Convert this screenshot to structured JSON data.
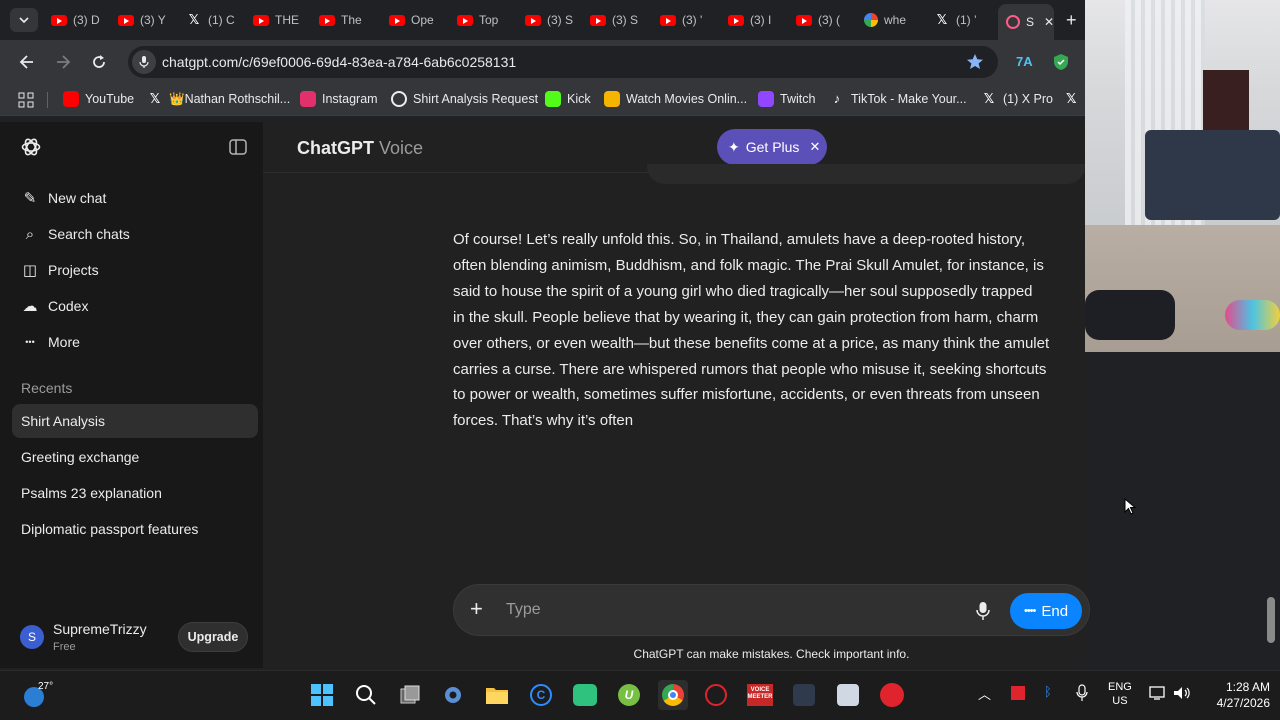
{
  "browser": {
    "tabs": [
      {
        "title": "(3) D",
        "icon": "youtube-icon"
      },
      {
        "title": "(3) Y",
        "icon": "youtube-icon"
      },
      {
        "title": "(1) C",
        "icon": "x-icon"
      },
      {
        "title": "THE",
        "icon": "youtube-icon"
      },
      {
        "title": "The",
        "icon": "youtube-icon"
      },
      {
        "title": "Ope",
        "icon": "youtube-icon"
      },
      {
        "title": "Top",
        "icon": "youtube-icon"
      },
      {
        "title": "(3) S",
        "icon": "youtube-icon"
      },
      {
        "title": "(3) S",
        "icon": "youtube-icon"
      },
      {
        "title": "(3) '",
        "icon": "youtube-icon"
      },
      {
        "title": "(3) I",
        "icon": "youtube-icon"
      },
      {
        "title": "(3) (",
        "icon": "youtube-icon"
      },
      {
        "title": "whe",
        "icon": "google-icon"
      },
      {
        "title": "(1) ’",
        "icon": "x-icon"
      },
      {
        "title": "S",
        "icon": "recording-icon"
      }
    ],
    "url": "chatgpt.com/c/69ef0006-69d4-83ea-a784-6ab6c0258131",
    "bookmarks": [
      {
        "label": "YouTube",
        "icon": "youtube-icon"
      },
      {
        "label": "👑Nathan Rothschil...",
        "icon": "x-icon"
      },
      {
        "label": "Instagram",
        "icon": "instagram-icon"
      },
      {
        "label": "Shirt Analysis Request",
        "icon": "chatgpt-icon"
      },
      {
        "label": "Kick",
        "icon": "kick-icon"
      },
      {
        "label": "Watch Movies Onlin...",
        "icon": "film-icon"
      },
      {
        "label": "Twitch",
        "icon": "twitch-icon"
      },
      {
        "label": "TikTok - Make Your...",
        "icon": "tiktok-icon"
      },
      {
        "label": "(1) X Pro",
        "icon": "x-icon"
      }
    ]
  },
  "sidebar": {
    "nav": [
      {
        "label": "New chat",
        "icon": "edit-icon"
      },
      {
        "label": "Search chats",
        "icon": "search-icon"
      },
      {
        "label": "Projects",
        "icon": "folder-icon"
      },
      {
        "label": "Codex",
        "icon": "codex-icon"
      },
      {
        "label": "More",
        "icon": "more-icon"
      }
    ],
    "recents_heading": "Recents",
    "recents": [
      "Shirt Analysis",
      "Greeting exchange",
      "Psalms 23 explanation",
      "Diplomatic passport features"
    ],
    "user": {
      "initial": "S",
      "name": "SupremeTrizzy",
      "plan": "Free",
      "upgrade_label": "Upgrade"
    }
  },
  "header": {
    "title": "ChatGPT",
    "subtitle": "Voice",
    "get_plus_label": "Get Plus"
  },
  "message": {
    "lines": [
      "Of course! Let’s really unfold this. So, in Thailand, amulets have a deep-rooted history,",
      "often blending animism, Buddhism, and folk magic. The Prai Skull Amulet, for instance, is",
      "said to house the spirit of a young girl who died tragically—her soul supposedly trapped",
      "in the skull. People believe that by wearing it, they can gain protection from harm, charm",
      "over others, or even wealth—but these benefits come at a price, as many think the amulet",
      "carries a curse. There are whispered rumors that people who misuse it, seeking shortcuts",
      "to power or wealth, sometimes suffer misfortune, accidents, or even threats from unseen",
      "forces. That’s why it’s often"
    ]
  },
  "composer": {
    "placeholder": "Type",
    "end_label": "End"
  },
  "disclaimer": "ChatGPT can make mistakes. Check important info.",
  "taskbar": {
    "weather": "27°",
    "language": "ENG",
    "region": "US",
    "time": "1:28 AM",
    "date": "4/27/2026",
    "voicemeeter_label": "VOICE MEETER"
  },
  "colors": {
    "accent_blue": "#0a84ff",
    "get_plus_bg": "#5b4fb8",
    "sidebar_bg": "#181818",
    "main_bg": "#212121"
  }
}
